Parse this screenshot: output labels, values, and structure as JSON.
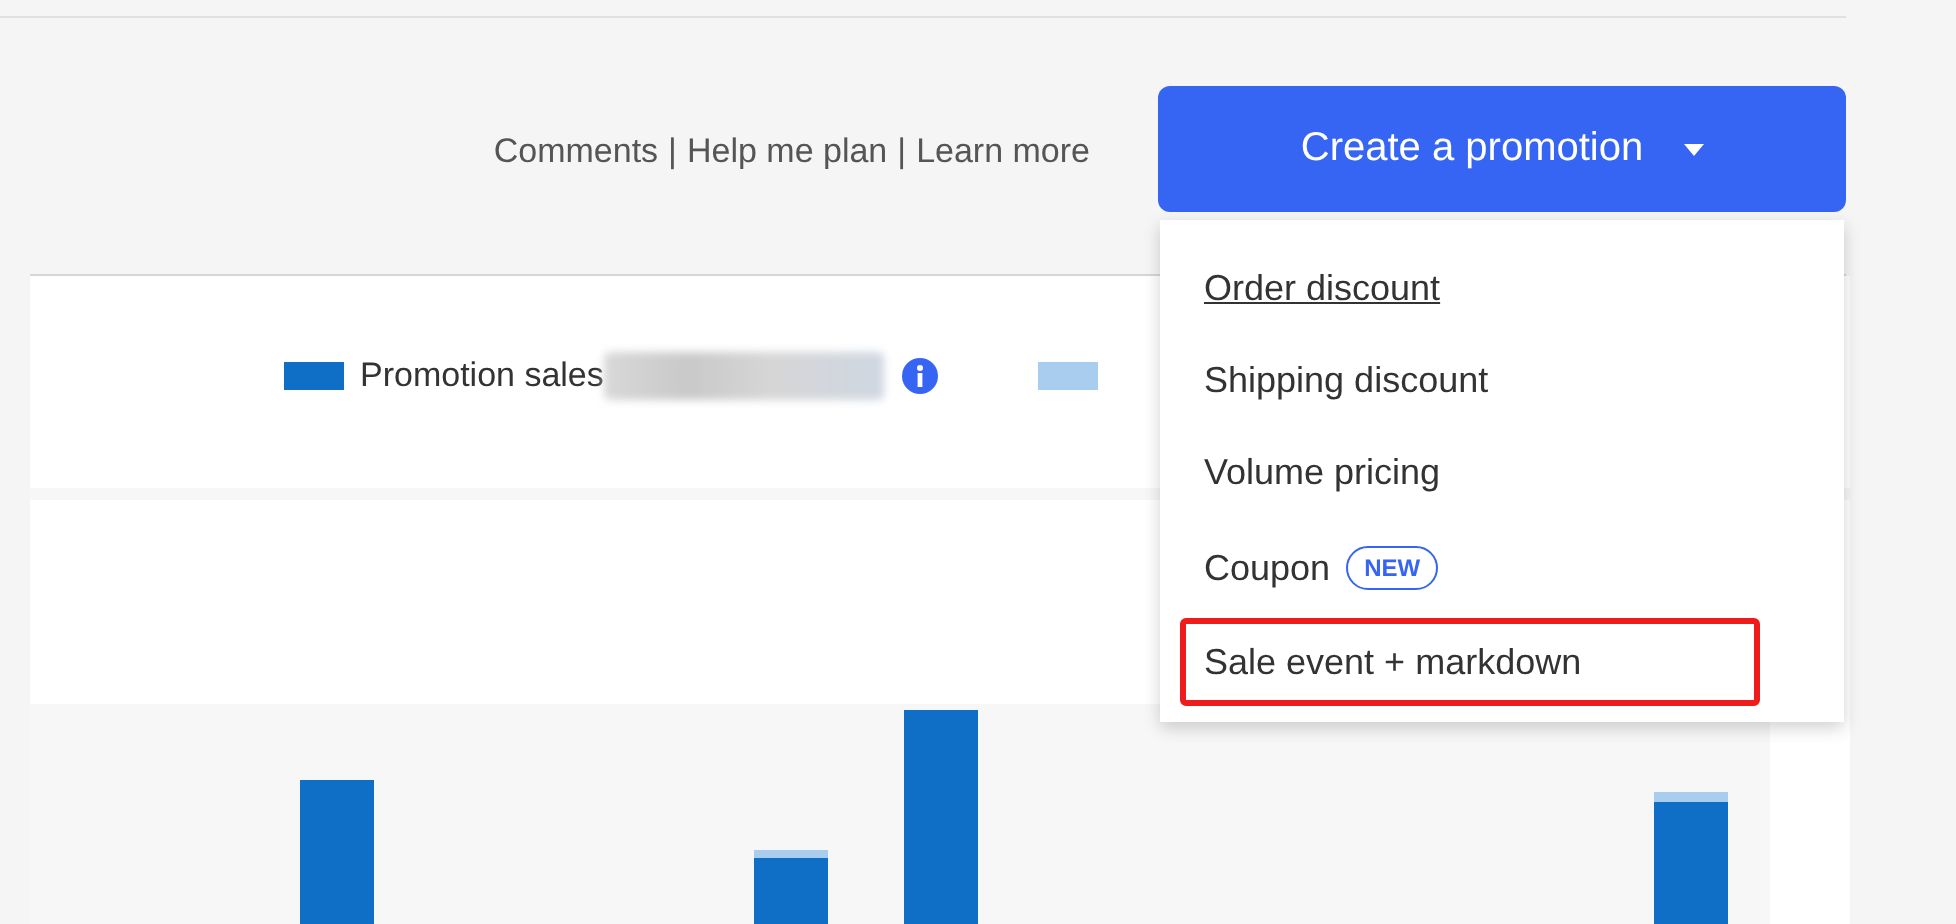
{
  "header": {
    "links": [
      {
        "label": "Comments"
      },
      {
        "label": "Help me plan"
      },
      {
        "label": "Learn more"
      }
    ],
    "separator": "|",
    "create_button": {
      "label": "Create a promotion",
      "expanded": true
    }
  },
  "legend": [
    {
      "label": "Promotion sales",
      "color": "#0f6ec6",
      "redacted": true,
      "info": true
    },
    {
      "color": "#a9cdee"
    }
  ],
  "menu": {
    "items": [
      {
        "label": "Order discount",
        "focused": true,
        "highlighted": false
      },
      {
        "label": "Shipping discount",
        "focused": false,
        "highlighted": false
      },
      {
        "label": "Volume pricing",
        "focused": false,
        "highlighted": false
      },
      {
        "label": "Coupon",
        "badge": "NEW",
        "focused": false,
        "highlighted": false
      },
      {
        "label": "Sale event + markdown",
        "focused": false,
        "highlighted": true
      }
    ]
  }
}
